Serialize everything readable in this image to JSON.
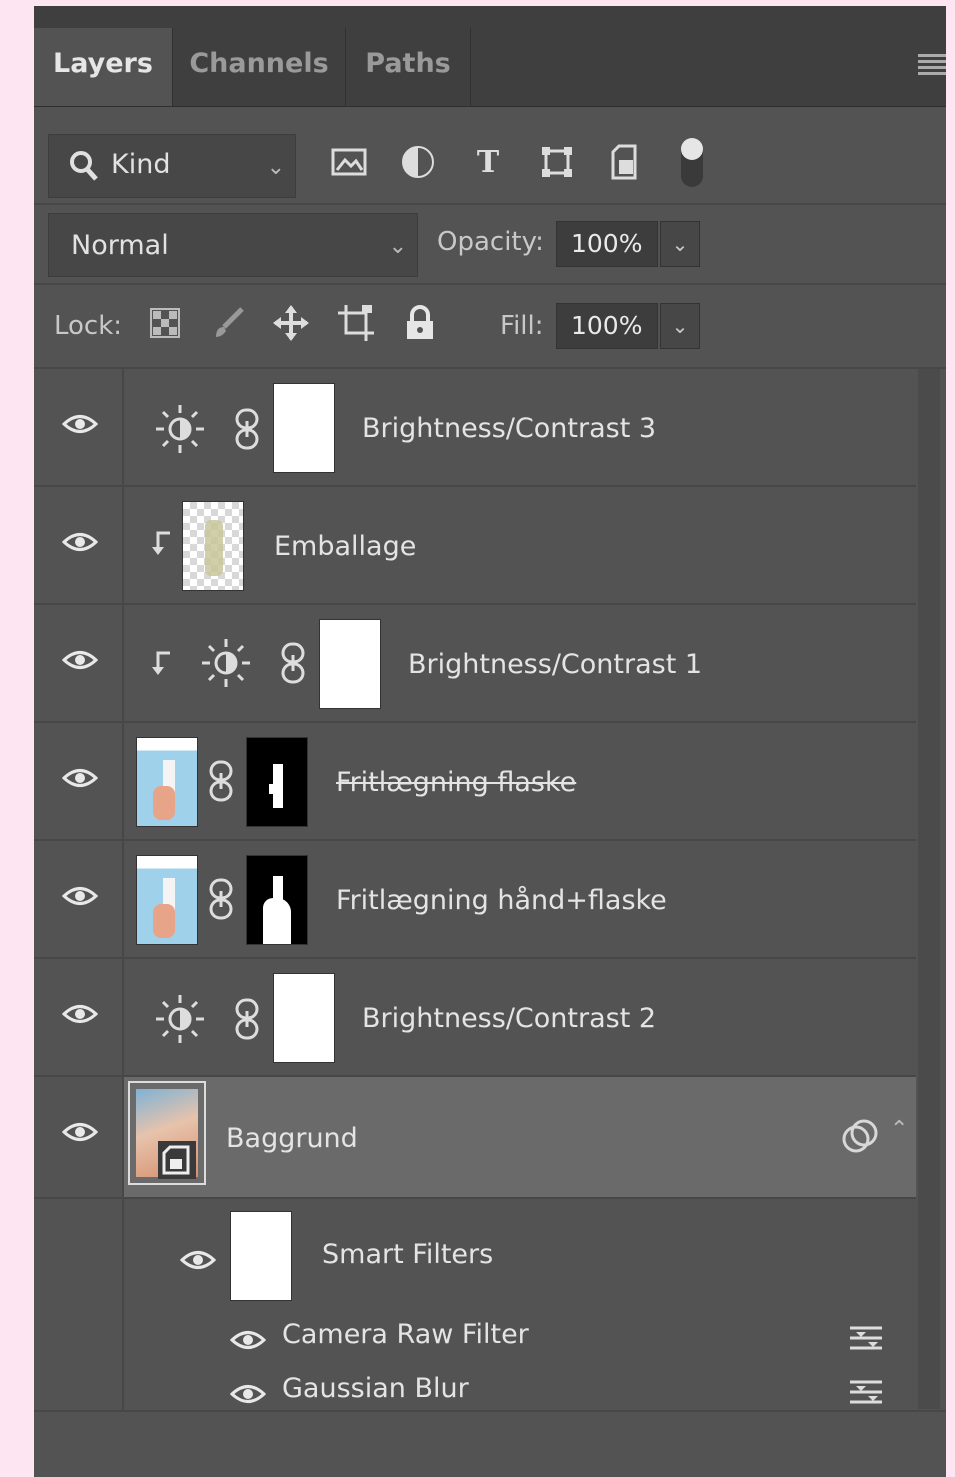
{
  "tabs": [
    {
      "label": "Layers",
      "active": true
    },
    {
      "label": "Channels",
      "active": false
    },
    {
      "label": "Paths",
      "active": false
    }
  ],
  "filter": {
    "kind_label": "Kind",
    "icons": [
      "image-filter-icon",
      "adjustment-filter-icon",
      "type-filter-icon",
      "shape-filter-icon",
      "smart-object-filter-icon",
      "filter-toggle-icon"
    ]
  },
  "blend": {
    "mode": "Normal",
    "opacity_label": "Opacity:",
    "opacity_value": "100%"
  },
  "lock": {
    "label": "Lock:",
    "icons": [
      "lock-transparent-pixels-icon",
      "lock-image-pixels-icon",
      "lock-position-icon",
      "lock-artboard-icon",
      "lock-all-icon"
    ],
    "fill_label": "Fill:",
    "fill_value": "100%"
  },
  "layers": [
    {
      "name": "Brightness/Contrast 3",
      "type": "adjustment",
      "clipped": false,
      "visible": true
    },
    {
      "name": "Emballage",
      "type": "pixel",
      "clipped": true,
      "visible": true
    },
    {
      "name": "Brightness/Contrast 1",
      "type": "adjustment",
      "clipped": true,
      "visible": true
    },
    {
      "name": "Fritlægning flaske ",
      "type": "masked-pixel",
      "clipped": false,
      "visible": true,
      "strikethrough": true
    },
    {
      "name": "Fritlægning hånd+flaske",
      "type": "masked-pixel",
      "clipped": false,
      "visible": true
    },
    {
      "name": "Brightness/Contrast 2",
      "type": "adjustment",
      "clipped": false,
      "visible": true
    },
    {
      "name": "Baggrund",
      "type": "smart-object",
      "selected": true,
      "visible": true
    }
  ],
  "smart_filters": {
    "label": "Smart Filters",
    "filters": [
      "Camera Raw Filter",
      "Gaussian Blur"
    ]
  }
}
